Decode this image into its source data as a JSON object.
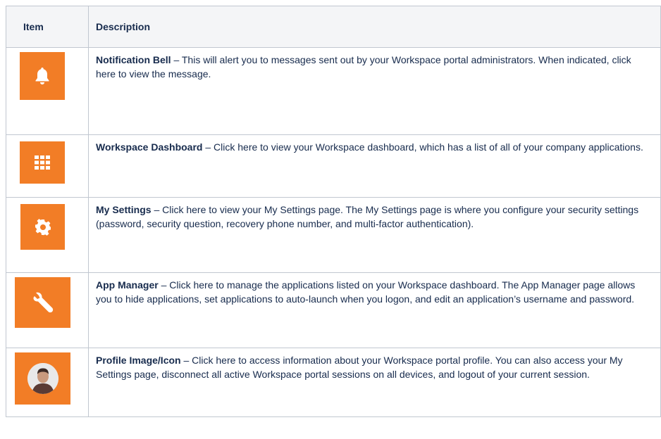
{
  "headers": {
    "item": "Item",
    "description": "Description"
  },
  "rows": [
    {
      "icon": "bell-icon",
      "title": "Notification Bell",
      "text": " – This will alert you to messages sent out by your Workspace portal administrators.  When indicated, click here to view the message."
    },
    {
      "icon": "grid-icon",
      "title": "Workspace Dashboard",
      "text": " – Click here to view your Workspace dashboard, which has a list of all of your company applications."
    },
    {
      "icon": "gear-icon",
      "title": "My Settings",
      "text": " – Click here to view your My Settings page.  The My Settings page is where you configure your security settings (password, security question, recovery phone number, and multi-factor authentication)."
    },
    {
      "icon": "wrench-icon",
      "title": "App Manager",
      "text": " – Click here to manage the applications listed on your Workspace dashboard.  The App Manager page allows you to hide applications, set applications to auto-launch when you logon, and edit an application’s username and password."
    },
    {
      "icon": "avatar-icon",
      "title": "Profile Image/Icon",
      "text": " – Click here to access information about your Workspace portal profile.  You can also access your My Settings page, disconnect all active Workspace portal sessions on all devices, and logout of your current session."
    }
  ],
  "colors": {
    "tile": "#f27d26",
    "border": "#c1c7d0",
    "header_bg": "#f4f5f7"
  }
}
